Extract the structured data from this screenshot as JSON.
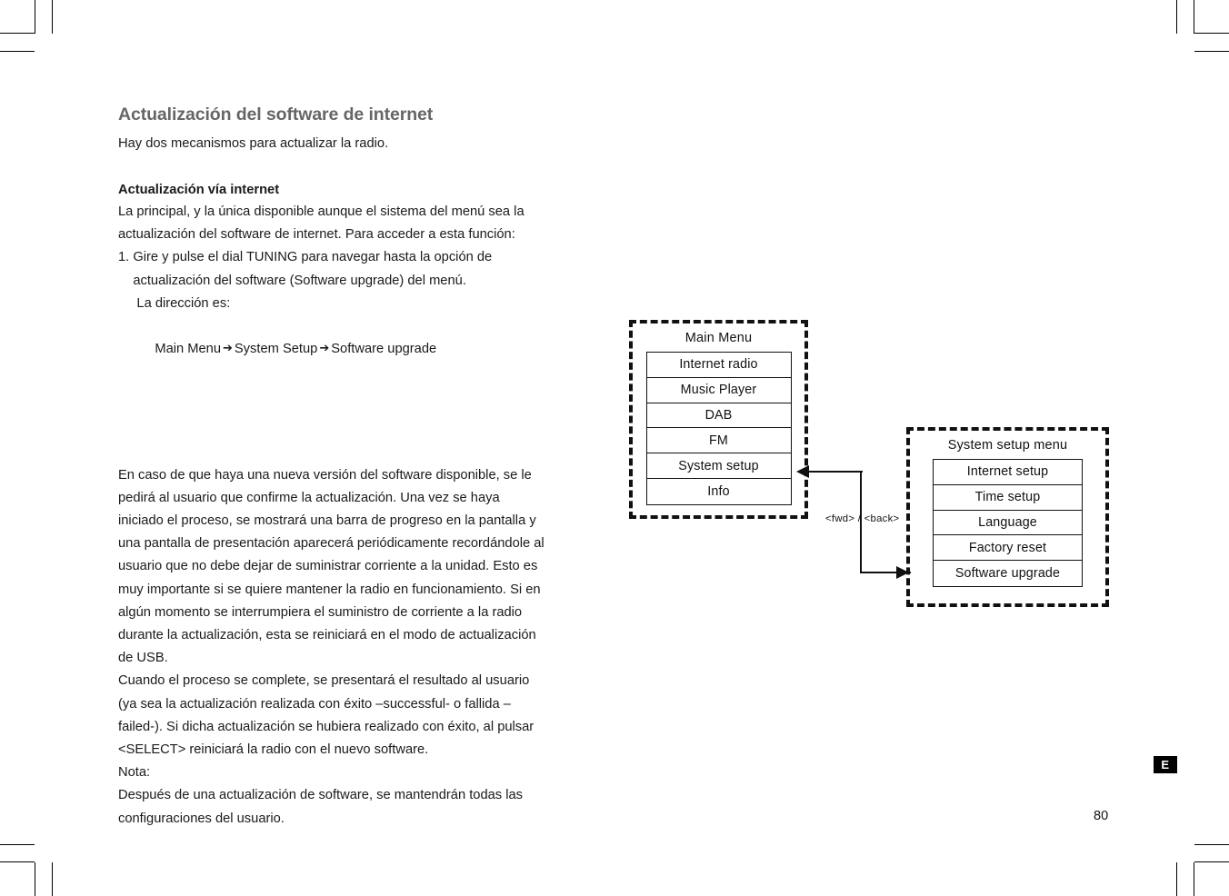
{
  "document": {
    "page_number": "80",
    "language_badge": "E"
  },
  "content": {
    "title": "Actualización del software de internet",
    "lead": "Hay dos mecanismos para actualizar la radio.",
    "subheading": "Actualización vía internet",
    "intro_lines": [
      "La principal, y la única disponible aunque el sistema del menú sea la",
      "actualización del software de internet. Para acceder a esta función:",
      "1. Gire y pulse el dial TUNING para navegar hasta la opción de",
      "    actualización del software (Software upgrade) del menú.",
      "     La dirección es:"
    ],
    "path": {
      "step1": "Main Menu",
      "arrow1": "➔",
      "step2": "System Setup",
      "arrow2": "➔",
      "step3": "Software upgrade"
    },
    "body_lines": [
      "En caso de que haya una nueva versión del software disponible, se le",
      "pedirá al usuario que confirme la actualización. Una vez se haya",
      "iniciado el proceso, se mostrará una barra de progreso en la pantalla y",
      "una pantalla de presentación aparecerá periódicamente recordándole al",
      "usuario que no debe dejar de suministrar corriente a la unidad. Esto es",
      "muy importante si se quiere mantener la radio en funcionamiento. Si en",
      "algún momento se interrumpiera el suministro de corriente a la radio",
      "durante la actualización, esta se reiniciará en el modo de actualización",
      "de USB.",
      "Cuando el proceso se complete, se presentará el resultado al usuario",
      "(ya sea la actualización realizada con éxito –successful- o fallida –",
      "failed-). Si dicha actualización se hubiera realizado con éxito, al pulsar",
      "<SELECT> reiniciará la radio con el nuevo software.",
      "Nota:",
      "Después de una actualización de software, se mantendrán todas las",
      "configuraciones del usuario."
    ]
  },
  "diagram": {
    "main_menu": {
      "title": "Main Menu",
      "items": [
        "Internet radio",
        "Music Player",
        "DAB",
        "FM",
        "System setup",
        "Info"
      ]
    },
    "system_setup_menu": {
      "title": "System setup menu",
      "items": [
        "Internet setup",
        "Time setup",
        "Language",
        "Factory reset",
        "Software upgrade"
      ]
    },
    "connector_label": "<fwd> / <back>"
  }
}
